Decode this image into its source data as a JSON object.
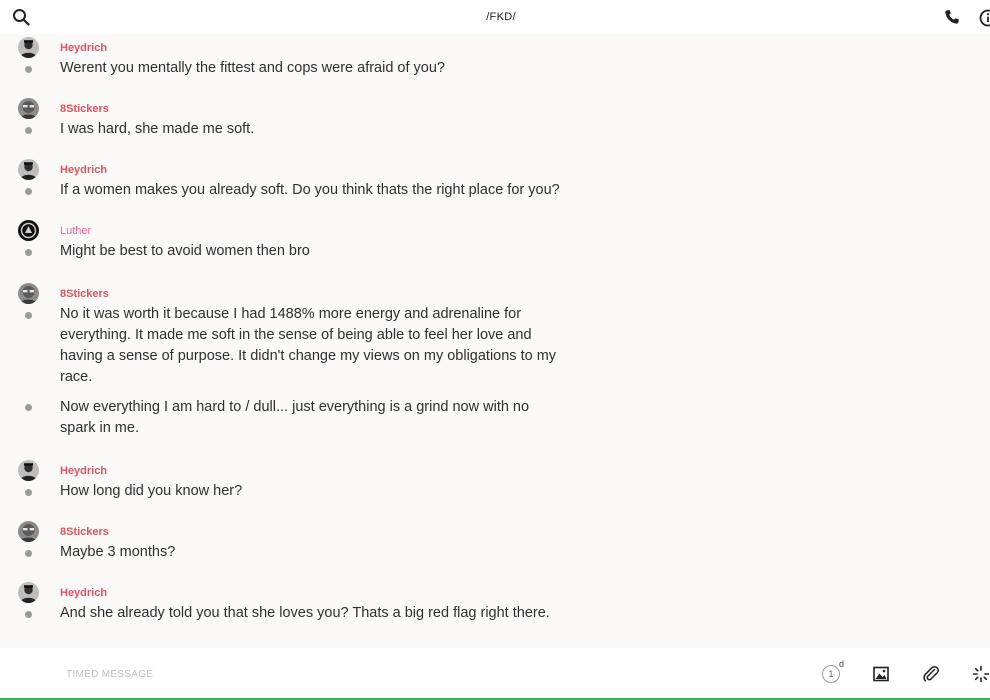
{
  "header": {
    "title": "/FKD/",
    "icons": [
      "search-icon",
      "phone-icon",
      "info-icon"
    ]
  },
  "messages": [
    {
      "author": "Heydrich",
      "avatar": "heydrich",
      "author_color": "#e0535f",
      "text": "Werent you mentally the fittest and cops were afraid of you?"
    },
    {
      "author": "8Stickers",
      "avatar": "stickers",
      "author_color": "#e0535f",
      "text": "I was hard, she made me soft."
    },
    {
      "author": "Heydrich",
      "avatar": "heydrich",
      "author_color": "#e0535f",
      "text": "If a women makes you already soft. Do you think thats the right place for you?"
    },
    {
      "author": "Luther",
      "avatar": "luther",
      "author_color": "#e8679b",
      "text": "Might be best to avoid women then bro"
    },
    {
      "author": "8Stickers",
      "avatar": "stickers",
      "author_color": "#e0535f",
      "text": "No it was worth it because I had 1488% more energy and adrenaline for everything. It made me soft in the sense of being able to feel her love and having a sense of purpose. It didn't change my views on my obligations to my race."
    },
    {
      "author": "",
      "avatar": "",
      "author_color": "",
      "text": "Now everything I am hard to / dull... just everything is a grind now with no spark in me."
    },
    {
      "author": "Heydrich",
      "avatar": "heydrich",
      "author_color": "#e0535f",
      "text": "How long did you know her?"
    },
    {
      "author": "8Stickers",
      "avatar": "stickers",
      "author_color": "#e0535f",
      "text": "Maybe 3 months?"
    },
    {
      "author": "Heydrich",
      "avatar": "heydrich",
      "author_color": "#e0535f",
      "text": "And she already told you that she loves you? Thats a big red flag right there."
    }
  ],
  "composer": {
    "placeholder": "TIMED MESSAGE",
    "timer_value": "1",
    "timer_unit": "d",
    "icons": [
      "image-icon",
      "paperclip-icon",
      "sparkle-icon"
    ]
  },
  "colors": {
    "author_red": "#e0535f",
    "author_pink": "#e8679b",
    "background": "#faf9f8",
    "accent_green": "#2fbf4f"
  }
}
